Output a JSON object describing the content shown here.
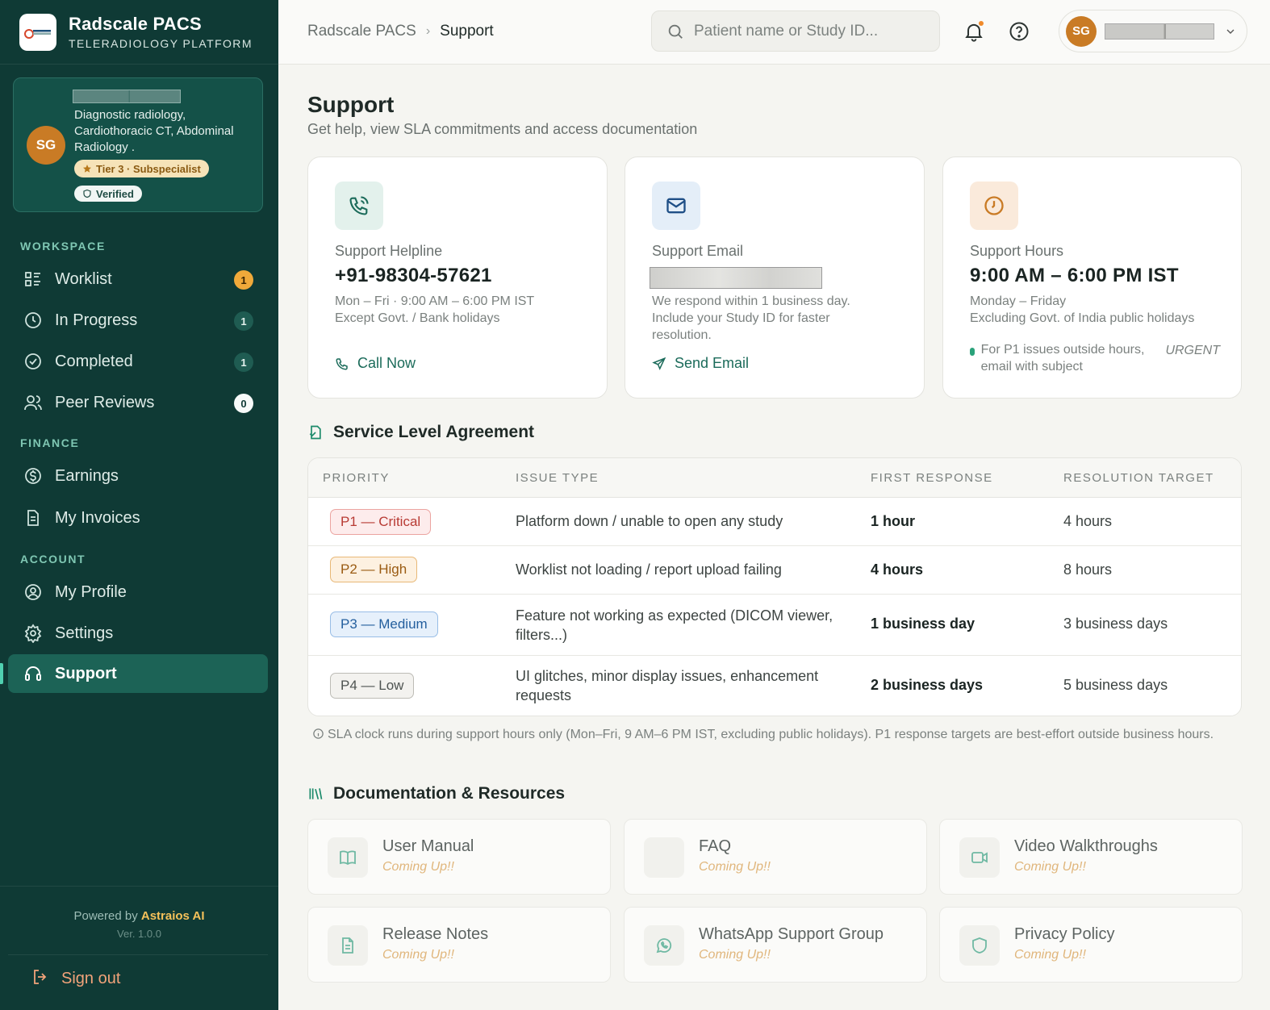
{
  "brand": {
    "name": "Radscale PACS",
    "subtitle": "TELERADIOLOGY PLATFORM"
  },
  "profile": {
    "initials": "SG",
    "specialty": "Diagnostic radiology, Cardiothoracic CT, Abdominal Radiology .",
    "tier": "Tier 3 · Subspecialist",
    "verified": "Verified"
  },
  "sidebar": {
    "sections": {
      "workspace": "WORKSPACE",
      "finance": "FINANCE",
      "account": "ACCOUNT"
    },
    "items": [
      {
        "label": "Worklist",
        "count": "1",
        "icon": "worklist-icon"
      },
      {
        "label": "In Progress",
        "count": "1",
        "icon": "clock-icon"
      },
      {
        "label": "Completed",
        "count": "1",
        "icon": "check-circle-icon"
      },
      {
        "label": "Peer Reviews",
        "count": "0",
        "icon": "users-icon"
      },
      {
        "label": "Earnings",
        "icon": "dollar-icon"
      },
      {
        "label": "My Invoices",
        "icon": "invoice-icon"
      },
      {
        "label": "My Profile",
        "icon": "user-circle-icon"
      },
      {
        "label": "Settings",
        "icon": "gear-icon"
      },
      {
        "label": "Support",
        "icon": "headset-icon",
        "active": true
      }
    ],
    "powered_prefix": "Powered by",
    "powered_brand": "Astraios AI",
    "version": "Ver. 1.0.0",
    "signout": "Sign out"
  },
  "topbar": {
    "breadcrumb": [
      "Radscale PACS",
      "Support"
    ],
    "search_placeholder": "Patient name or Study ID...",
    "user_initials": "SG"
  },
  "page": {
    "title": "Support",
    "subtitle": "Get help, view SLA commitments and access documentation"
  },
  "contact_cards": {
    "helpline": {
      "label": "Support Helpline",
      "value": "+91-98304-57621",
      "note_1": "Mon – Fri · 9:00 AM – 6:00 PM IST",
      "note_2": "Except Govt. / Bank holidays",
      "action": "Call Now"
    },
    "email": {
      "label": "Support Email",
      "note": "We respond within 1 business day. Include your Study ID for faster resolution.",
      "action": "Send Email"
    },
    "hours": {
      "label": "Support Hours",
      "value": "9:00 AM – 6:00 PM IST",
      "note_1": "Monday – Friday",
      "note_2": "Excluding Govt. of India public holidays",
      "urgent_text": "For P1 issues outside hours, email with subject",
      "urgent_tag": "URGENT"
    }
  },
  "sla": {
    "heading": "Service Level Agreement",
    "columns": [
      "PRIORITY",
      "ISSUE TYPE",
      "FIRST RESPONSE",
      "RESOLUTION TARGET"
    ],
    "rows": [
      {
        "priority": "P1 — Critical",
        "issue": "Platform down / unable to open any study",
        "first": "1 hour",
        "resolution": "4 hours"
      },
      {
        "priority": "P2 — High",
        "issue": "Worklist not loading / report upload failing",
        "first": "4 hours",
        "resolution": "8 hours"
      },
      {
        "priority": "P3 — Medium",
        "issue": "Feature not working as expected (DICOM viewer, filters...)",
        "first": "1 business day",
        "resolution": "3 business days"
      },
      {
        "priority": "P4 — Low",
        "issue": "UI glitches, minor display issues, enhancement requests",
        "first": "2 business days",
        "resolution": "5 business days"
      }
    ],
    "note": "SLA clock runs during support hours only (Mon–Fri, 9 AM–6 PM IST, excluding public holidays). P1 response targets are best-effort outside business hours."
  },
  "docs": {
    "heading": "Documentation & Resources",
    "items": [
      {
        "title": "User Manual",
        "status": "Coming Up!!"
      },
      {
        "title": "FAQ",
        "status": "Coming Up!!"
      },
      {
        "title": "Video Walkthroughs",
        "status": "Coming Up!!"
      },
      {
        "title": "Release Notes",
        "status": "Coming Up!!"
      },
      {
        "title": "WhatsApp Support Group",
        "status": "Coming Up!!"
      },
      {
        "title": "Privacy Policy",
        "status": "Coming Up!!"
      }
    ]
  },
  "colors": {
    "sidebar_bg": "#0f3a35",
    "accent": "#1b6b5a",
    "avatar": "#c97b25",
    "p1": "#d2504a",
    "p2": "#d18a2a",
    "p3": "#2f6fb6",
    "p4": "#6b6f6d"
  }
}
